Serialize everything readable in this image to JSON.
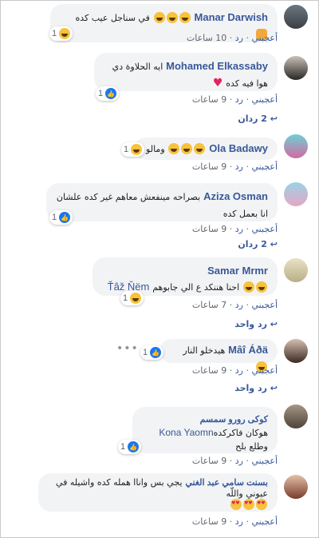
{
  "meta_like": "أعجبني",
  "meta_reply": "رد",
  "comments": [
    {
      "name": "Manar Darwish",
      "text": "في سناجل عيب كده",
      "time": "10 ساعات",
      "react_count": "1"
    },
    {
      "name": "Mohamed Elkassaby",
      "text": "ايه الحلاوة دي",
      "text2": "هوا فيه كده",
      "time": "9 ساعات",
      "react_count": "1",
      "replies": "2 ردان"
    },
    {
      "name": "Ola Badawy",
      "text": "ومالو",
      "time": "9 ساعات",
      "react_count": "1"
    },
    {
      "name": "Aziza Osman",
      "text": "بصراحه مينفعش معاهم غير كده علشان",
      "text2": "انا بعمل كده",
      "time": "9 ساعات",
      "react_count": "1",
      "replies": "2 ردان"
    },
    {
      "name": "Samar Mrmr",
      "text": "احنا هننكد ع الي جابوهم",
      "mention": "Ťâž Ňëm",
      "time": "7 ساعات",
      "react_count": "1",
      "replies": "رد واحد"
    },
    {
      "name": "Mâî Áðä",
      "text": "هيدخلو النار",
      "time": "9 ساعات",
      "react_count": "1",
      "replies": "رد واحد",
      "dots": "•••"
    },
    {
      "name": "كوكى رورو سمسم",
      "text": "هوكان فاكركده",
      "mention": "Kona Yaomn",
      "text2": "وطلع بلح",
      "time": "9 ساعات",
      "react_count": "1"
    },
    {
      "name": "بسنت سامي عبد الغني",
      "text": "يجي بس واناا همله كده واشيله في",
      "text2": "عيوني واللّه",
      "time": "9 ساعات"
    }
  ]
}
